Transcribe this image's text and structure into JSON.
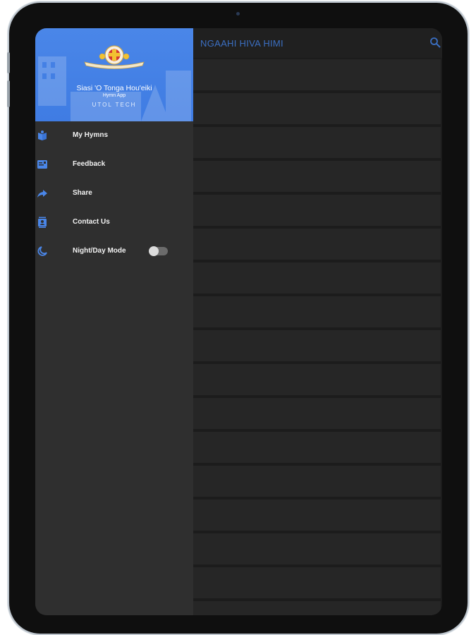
{
  "appbar": {
    "title": "NGAAHI HIVA HIMI",
    "search_icon": "search-icon"
  },
  "drawer": {
    "header": {
      "title": "Siasi 'O Tonga Hou'eiki",
      "subtitle": "Hymn App",
      "tagline": "UTOL TECH"
    },
    "items": [
      {
        "label": "My Hymns",
        "icon": "book-icon"
      },
      {
        "label": "Feedback",
        "icon": "feedback-icon"
      },
      {
        "label": "Share",
        "icon": "share-icon"
      },
      {
        "label": "Contact Us",
        "icon": "contact-icon"
      },
      {
        "label": "Night/Day Mode",
        "icon": "night-mode-icon"
      }
    ],
    "night_mode_on": false
  },
  "colors": {
    "accent": "#4a86e8",
    "drawer_bg": "#2f2f2f",
    "list_bg": "#1c1c1c"
  }
}
